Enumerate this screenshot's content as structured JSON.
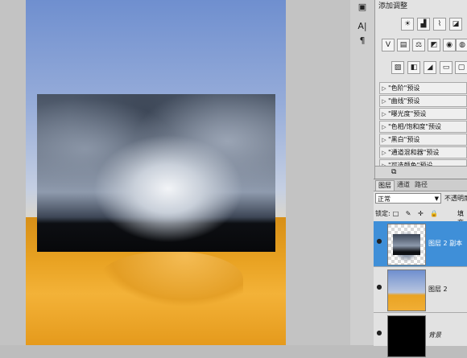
{
  "canvas": {
    "top_layer_name": "图层 2 副本"
  },
  "tool_strip": {
    "buttons": [
      {
        "icon": "info-icon",
        "glyph": "▣"
      },
      {
        "icon": "character-icon",
        "glyph": "A|"
      },
      {
        "icon": "paragraph-icon",
        "glyph": "¶"
      }
    ]
  },
  "adjustments": {
    "title": "添加调整",
    "icon_rows": [
      [
        {
          "icon": "brightness-icon",
          "glyph": "☀"
        },
        {
          "icon": "levels-icon",
          "glyph": "▟"
        },
        {
          "icon": "curves-icon",
          "glyph": "⌇"
        },
        {
          "icon": "exposure-icon",
          "glyph": "◪"
        }
      ],
      [
        {
          "icon": "vibrance-icon",
          "glyph": "V"
        },
        {
          "icon": "hue-saturation-icon",
          "glyph": "▤"
        },
        {
          "icon": "color-balance-icon",
          "glyph": "⚖"
        },
        {
          "icon": "black-white-icon",
          "glyph": "◩"
        },
        {
          "icon": "photo-filter-icon",
          "glyph": "◉"
        },
        {
          "icon": "channel-mixer-icon",
          "glyph": "◍"
        }
      ],
      [
        {
          "icon": "invert-icon",
          "glyph": "▨"
        },
        {
          "icon": "posterize-icon",
          "glyph": "◧"
        },
        {
          "icon": "threshold-icon",
          "glyph": "◢"
        },
        {
          "icon": "gradient-map-icon",
          "glyph": "▭"
        },
        {
          "icon": "selective-color-icon",
          "glyph": "▢"
        }
      ]
    ],
    "presets": [
      "\"色阶\"预设",
      "\"曲线\"预设",
      "\"曝光度\"预设",
      "\"色相/饱和度\"预设",
      "\"黑白\"预设",
      "\"通道混和器\"预设",
      "\"可选颜色\"预设"
    ]
  },
  "layers": {
    "tabs": [
      "图层",
      "通道",
      "路径"
    ],
    "blend_mode": "正常",
    "opacity_label": "不透明度",
    "lock_label": "锁定:",
    "lock_icons": "□ ✎ ✛ 🔒",
    "fill_label": "填充",
    "items": [
      {
        "name": "图层 2 副本",
        "selected": true
      },
      {
        "name": "图层 2",
        "selected": false
      },
      {
        "name": "背景",
        "selected": false
      }
    ]
  }
}
